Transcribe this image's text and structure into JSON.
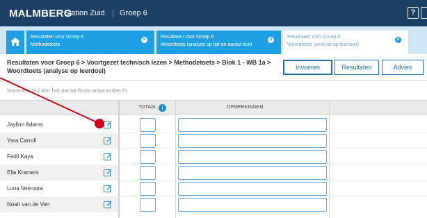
{
  "header": {
    "logo": "MALMBERG",
    "school": "Station Zuid",
    "separator": "|",
    "group": "Groep 6",
    "help_label": "?"
  },
  "tabs": [
    {
      "line1": "Resultaten voor Groep 6",
      "line2": "Methodetoets",
      "active": false
    },
    {
      "line1": "Resultaten voor Groep 6",
      "line2": "Woordtoets (analyse op tijd en aantal fout)",
      "active": false
    },
    {
      "line1": "Resultaten voor Groep 6",
      "line2": "Woordtoets (analyse op leerdoel)",
      "active": true
    }
  ],
  "tab_close_glyph": "×",
  "page": {
    "title": "Resultaten voor Groep 6 > Voortgezet technisch lezen > Methodetoets > Blok 1 - WB 1a > Woordtoets (analyse op leerdoel)",
    "buttons": {
      "invoeren": "Invoeren",
      "resultaten": "Resultaten",
      "advies": "Advies"
    },
    "instruction": "Invoeren: Vul hier het aantal foute antwoorden in."
  },
  "table": {
    "col_totaal": "TOTAAL",
    "info_glyph": "i",
    "col_opmerkingen": "OPMERKINGEN",
    "students": [
      "Jaylinn Adams",
      "Yara Carroll",
      "Fadil Kaya",
      "Ella Kramers",
      "Luna Veenstra",
      "Noah van de Ven"
    ]
  },
  "colors": {
    "topbar": "#1c3f66",
    "tab_active_bg": "#ffffff",
    "tab_bg": "#1fa0e4",
    "accent": "#1f6fb4",
    "annotation": "#d0021b"
  },
  "icons": {
    "home": "home-icon",
    "close": "close-icon",
    "info": "info-icon",
    "edit": "edit-icon",
    "help": "help-icon"
  }
}
